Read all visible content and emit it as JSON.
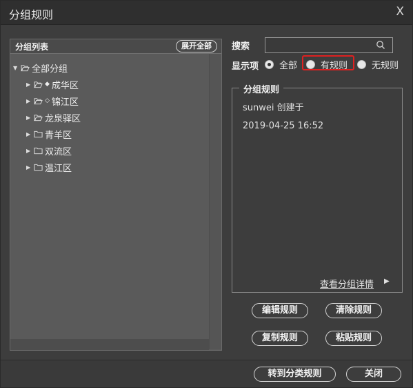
{
  "window": {
    "title": "分组规则",
    "close_label": "X"
  },
  "group_list": {
    "header": "分组列表",
    "expand_all_label": "展开全部",
    "items": [
      {
        "label": "全部分组",
        "marker": ""
      },
      {
        "label": "成华区",
        "marker": "◆"
      },
      {
        "label": "锦江区",
        "marker": "◇"
      },
      {
        "label": "龙泉驿区",
        "marker": ""
      },
      {
        "label": "青羊区",
        "marker": ""
      },
      {
        "label": "双流区",
        "marker": ""
      },
      {
        "label": "温江区",
        "marker": ""
      }
    ]
  },
  "search": {
    "label": "搜索",
    "value": "",
    "placeholder": ""
  },
  "display": {
    "label": "显示项",
    "options": [
      "全部",
      "有规则",
      "无规则"
    ],
    "selected": "全部"
  },
  "rule_info": {
    "legend": "分组规则",
    "creator_line": "sunwei 创建于",
    "timestamp": "2019-04-25 16:52",
    "detail_link": "查看分组详情"
  },
  "actions": {
    "edit_rule": "编辑规则",
    "clear_rule": "清除规则",
    "copy_rule": "复制规则",
    "paste_rule": "粘贴规则"
  },
  "footer": {
    "to_classify": "转到分类规则",
    "close": "关闭"
  },
  "colors": {
    "highlight": "#e02020",
    "background": "#3d3d3d"
  }
}
